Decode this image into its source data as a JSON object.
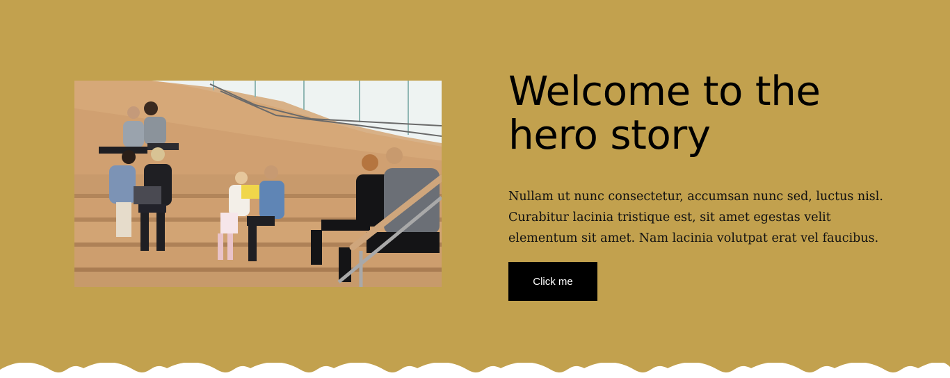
{
  "hero": {
    "title_line1": "Welcome to the",
    "title_line2": "hero story",
    "body": "Nullam ut nunc consectetur, accumsan nunc sed, luctus nisl. Curabitur lacinia tristique est, sit amet egestas velit elementum sit amet. Nam lacinia volutpat erat vel faucibus.",
    "button_label": "Click me"
  },
  "colors": {
    "background": "#c2a14e",
    "button": "#000000",
    "button_text": "#ffffff",
    "wave": "#ffffff"
  }
}
